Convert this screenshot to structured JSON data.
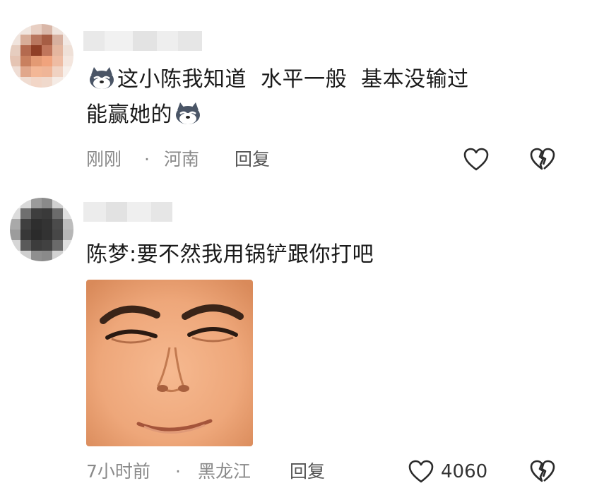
{
  "comments": [
    {
      "text_line1": "这小陈我知道  水平一般  基本没输过",
      "text_line2": "能赢她的",
      "emoji_icon": "husky-dog-emoji-icon",
      "time": "刚刚",
      "separator": "·",
      "location": "河南",
      "reply_label": "回复",
      "like_count": ""
    },
    {
      "text_line1": "陈梦:要不然我用锅铲跟你打吧",
      "sticker_icon": "smirking-face-sticker",
      "time": "7小时前",
      "separator": "·",
      "location": "黑龙江",
      "reply_label": "回复",
      "like_count": "4060"
    }
  ],
  "icons": {
    "like": "heart-outline-icon",
    "dislike": "broken-heart-icon"
  },
  "colors": {
    "text_primary": "#1a1a1a",
    "text_meta": "#8a8a8a",
    "icon_stroke": "#2b2b2b"
  }
}
